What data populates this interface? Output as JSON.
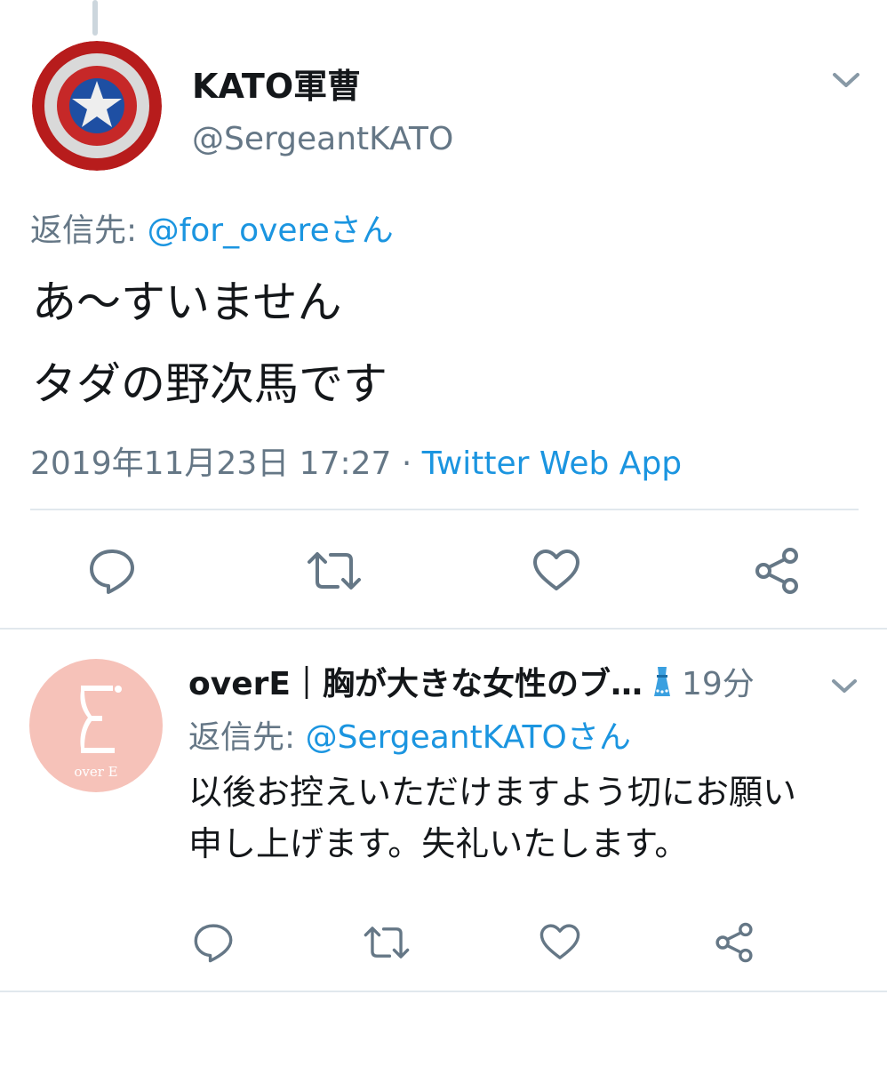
{
  "tweet": {
    "author_name": "KATO軍曹",
    "author_handle": "@SergeantKATO",
    "reply_prefix": "返信先: ",
    "reply_target": "@for_overeさん",
    "text_line1": "あ～すいません",
    "text_line2": "タダの野次馬です",
    "timestamp": "2019年11月23日 17:27",
    "meta_separator": " · ",
    "client": "Twitter Web App"
  },
  "reply": {
    "author_name": "overE｜胸が大きな女性のブ…",
    "time": "19分",
    "reply_prefix": "返信先: ",
    "reply_target": "@SergeantKATOさん",
    "text_line1": "以後お控えいただけますよう切にお願い",
    "text_line2": "申し上げます。失礼いたします。",
    "avatar_text": "over E"
  },
  "icons": {
    "reply": "reply-icon",
    "retweet": "retweet-icon",
    "like": "heart-icon",
    "share": "share-icon",
    "more": "chevron-down-icon"
  },
  "colors": {
    "link": "#1b95e0",
    "secondary_text": "#657786",
    "divider": "#e1e8ed",
    "avatar2_bg": "#f6c2b9"
  }
}
